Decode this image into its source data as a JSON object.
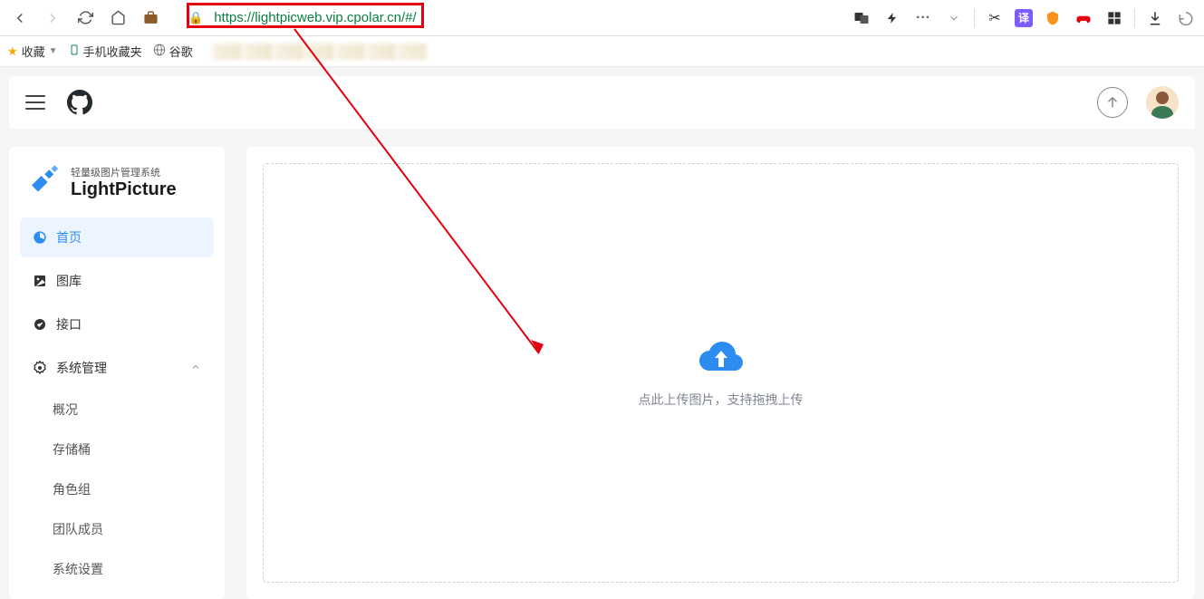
{
  "browser": {
    "url": "https://lightpicweb.vip.cpolar.cn/#/"
  },
  "bookmarks": {
    "favorites": "收藏",
    "mobile_favorites": "手机收藏夹",
    "google": "谷歌"
  },
  "logo": {
    "subtitle": "轻量级图片管理系统",
    "title": "LightPicture"
  },
  "sidebar": {
    "home": "首页",
    "gallery": "图库",
    "api": "接口",
    "system": "系统管理",
    "subitems": {
      "overview": "概况",
      "storage": "存储桶",
      "roles": "角色组",
      "team": "团队成员",
      "settings": "系统设置"
    }
  },
  "upload": {
    "hint": "点此上传图片，支持拖拽上传"
  }
}
